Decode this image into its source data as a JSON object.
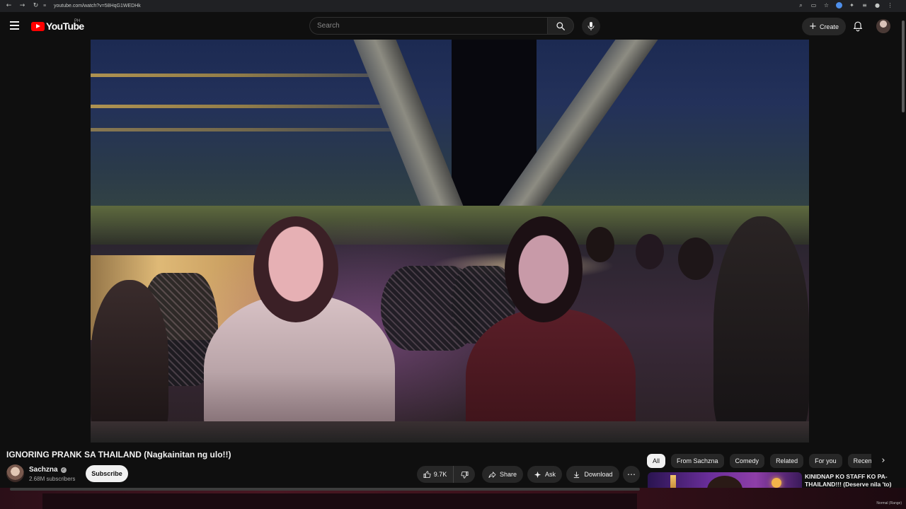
{
  "browser": {
    "url": "youtube.com/watch?v=58HqG1WEDHk"
  },
  "header": {
    "logo_text": "YouTube",
    "region": "PH",
    "search_placeholder": "Search",
    "create_label": "Create"
  },
  "video": {
    "title": "IGNORING PRANK SA THAILAND (Nagkainitan ng ulo!!)",
    "channel": "Sachzna",
    "subscribers": "2.68M subscribers",
    "subscribe_label": "Subscribe",
    "likes": "9.7K",
    "share_label": "Share",
    "ask_label": "Ask",
    "download_label": "Download"
  },
  "chips": [
    "All",
    "From Sachzna",
    "Comedy",
    "Related",
    "For you",
    "Recently uploaded"
  ],
  "recommendation": {
    "title": "KINIDNAP KO STAFF KO PA-THAILAND!!! (Deserve nila 'to)"
  },
  "status": {
    "zoom_label": "Normal (Range)"
  },
  "icons": {
    "menu": "hamburger-icon",
    "search": "search-icon",
    "mic": "microphone-icon",
    "bell": "bell-icon",
    "like": "thumbs-up-icon",
    "dislike": "thumbs-down-icon",
    "share": "share-arrow-icon",
    "ask": "sparkle-icon",
    "download": "download-icon",
    "more": "more-horizontal-icon",
    "verified": "verified-check-icon"
  },
  "colors": {
    "brand_red": "#ff0000",
    "background": "#0f0f0f",
    "chip_active": "#f1f1f1"
  }
}
